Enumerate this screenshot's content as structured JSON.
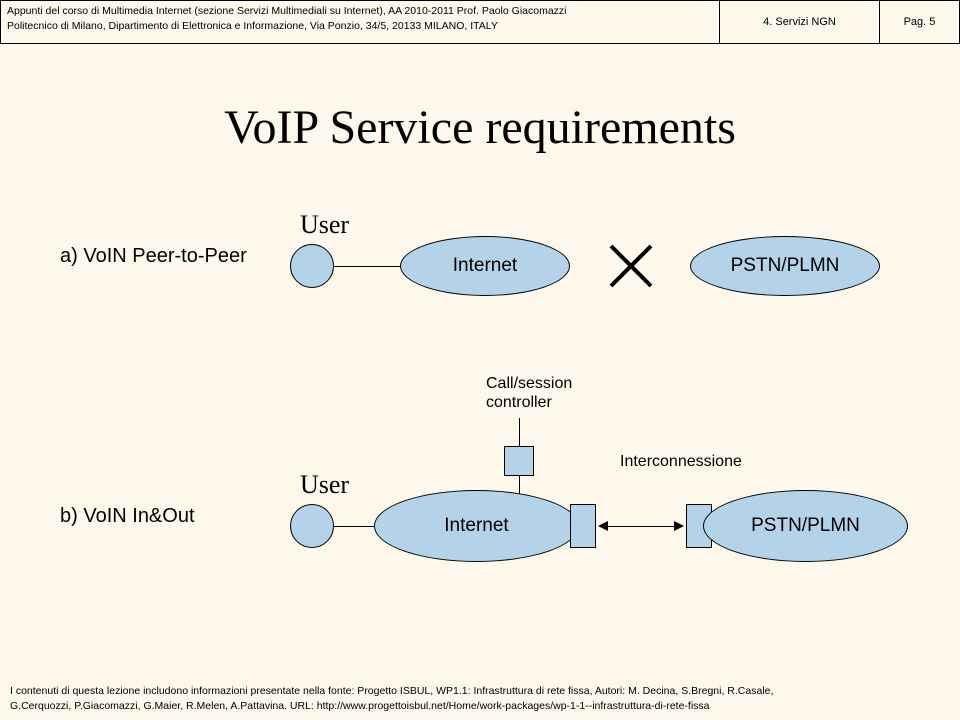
{
  "header": {
    "line1": "Appunti del corso di Multimedia Internet (sezione Servizi Multimediali su Internet), AA 2010-2011 Prof. Paolo Giacomazzi",
    "line2": "Politecnico di Milano, Dipartimento di Elettronica e Informazione, Via Ponzio, 34/5, 20133 MILANO, ITALY",
    "section": "4. Servizi NGN",
    "page": "Pag. 5"
  },
  "title": "VoIP Service requirements",
  "diagram_a": {
    "label": "a) VoIN Peer-to-Peer",
    "user": "User",
    "cloud1": "Internet",
    "cloud2": "PSTN/PLMN"
  },
  "diagram_b": {
    "label": "b) VoIN In&Out",
    "user": "User",
    "cloud1": "Internet",
    "cloud2": "PSTN/PLMN",
    "controller": "Call/session\ncontroller",
    "interconn": "Interconnessione"
  },
  "footer": {
    "line1": "I contenuti di questa lezione includono informazioni presentate nella fonte: Progetto ISBUL, WP1.1: Infrastruttura di rete fissa, Autori: M. Decina, S.Bregni, R.Casale,",
    "line2": "G.Cerquozzi, P.Giacomazzi, G.Maier, R.Melen, A.Pattavina. URL: http://www.progettoisbul.net/Home/work-packages/wp-1-1--infrastruttura-di-rete-fissa"
  }
}
